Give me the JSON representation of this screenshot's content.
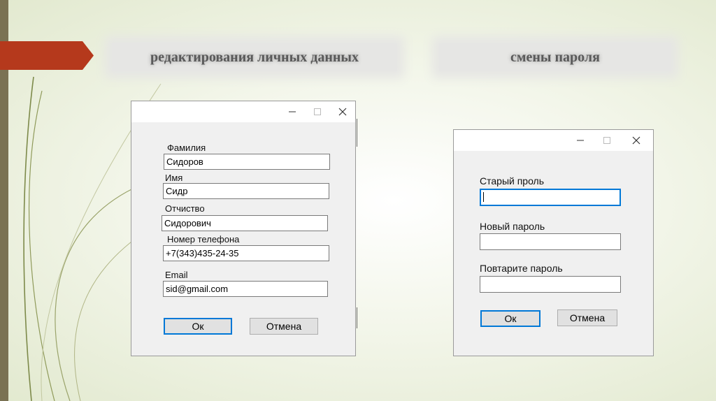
{
  "colors": {
    "accent_arrow": "#b5391c",
    "left_bar": "#7a7253",
    "focus_border": "#0078d7",
    "window_bg": "#f0f0f0"
  },
  "headings": {
    "left": "редактирования личных данных",
    "right": "смены пароля"
  },
  "profile_window": {
    "controls": [
      "minimize-icon",
      "maximize-icon",
      "close-icon"
    ],
    "fields": [
      {
        "label": "Фамилия",
        "value": "Сидоров"
      },
      {
        "label": "Имя",
        "value": "Сидр"
      },
      {
        "label": "Отчиство",
        "value": "Сидорович"
      },
      {
        "label": "Номер телефона",
        "value": "+7(343)435-24-35"
      },
      {
        "label": "Email",
        "value": "sid@gmail.com"
      }
    ],
    "ok_label": "Ок",
    "cancel_label": "Отмена"
  },
  "password_window": {
    "controls": [
      "minimize-icon",
      "maximize-icon",
      "close-icon"
    ],
    "fields": [
      {
        "label": "Старый проль",
        "value": ""
      },
      {
        "label": "Новый пароль",
        "value": ""
      },
      {
        "label": "Повтарите пароль",
        "value": ""
      }
    ],
    "ok_label": "Ок",
    "cancel_label": "Отмена"
  }
}
